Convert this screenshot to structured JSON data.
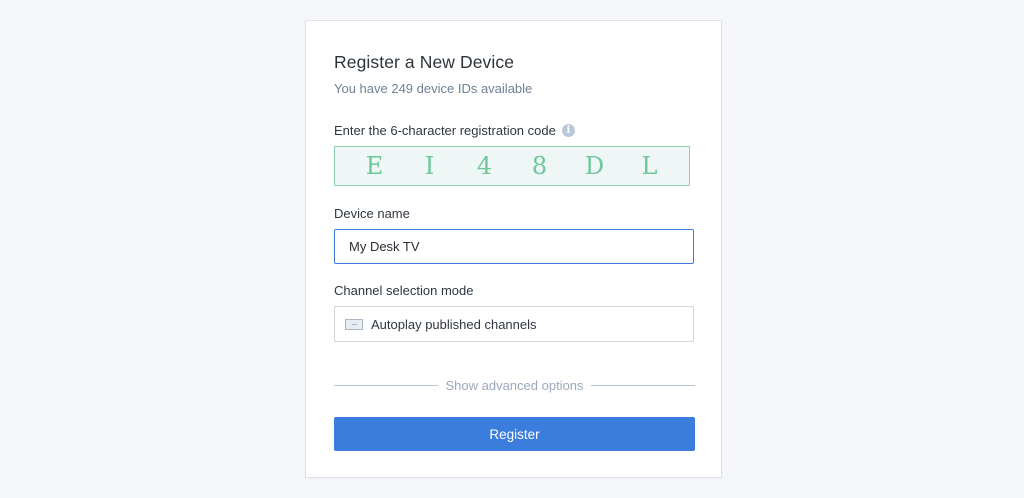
{
  "form": {
    "title": "Register a New Device",
    "subtitle": "You have 249 device IDs available",
    "code_label": "Enter the 6-character registration code",
    "info_icon": "info-icon",
    "code_chars": [
      "E",
      "I",
      "4",
      "8",
      "D",
      "L"
    ],
    "device_name_label": "Device name",
    "device_name_value": "My Desk TV",
    "channel_mode_label": "Channel selection mode",
    "channel_mode_icon": "playlist-icon",
    "channel_mode_value": "Autoplay published channels",
    "advanced_options": "Show advanced options",
    "register_label": "Register"
  },
  "colors": {
    "background": "#f4f6f9",
    "accent": "#3b7ddd",
    "code_text": "#6dc89a",
    "code_border": "#8fd2ad",
    "code_background": "#eef7f5",
    "subtitle": "#6f8196"
  }
}
